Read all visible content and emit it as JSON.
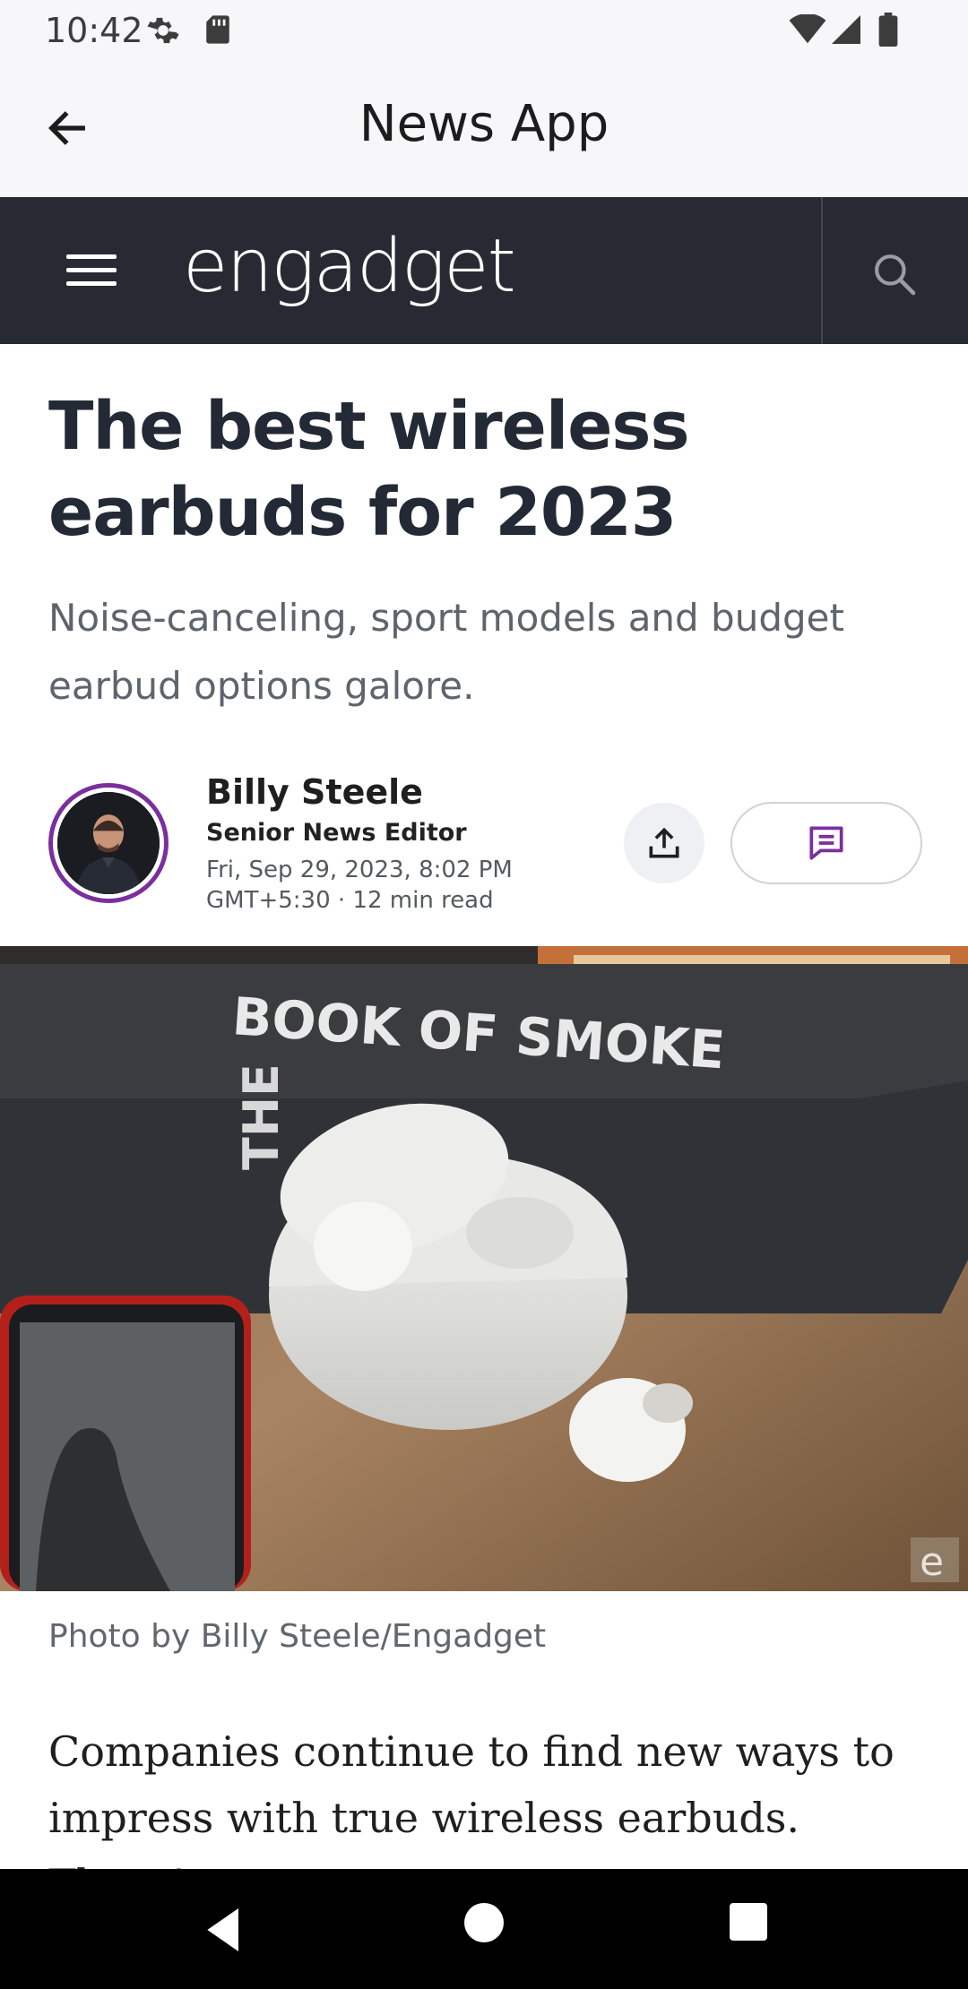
{
  "status_bar": {
    "time": "10:42",
    "icons": [
      "settings-gear-icon",
      "sd-card-icon",
      "wifi-icon",
      "cell-signal-icon",
      "battery-icon"
    ]
  },
  "app_bar": {
    "title": "News App",
    "back_icon": "arrow-left-icon"
  },
  "site_header": {
    "logo": "engadget",
    "menu_icon": "hamburger-menu-icon",
    "search_icon": "search-icon",
    "background": "#272a33"
  },
  "article": {
    "headline": "The best wireless earbuds for 2023",
    "subhead": "Noise-canceling, sport models and budget earbud options galore.",
    "author": {
      "name": "Billy Steele",
      "role": "Senior News Editor",
      "date_line1": "Fri, Sep 29, 2023, 8:02 PM",
      "date_line2": "GMT+5:30 · 12 min read",
      "avatar_ring_color": "#7b2f9e"
    },
    "actions": {
      "share_icon": "share-upload-icon",
      "comment_icon": "comment-icon",
      "comment_color": "#7b2f9e"
    },
    "hero_image": {
      "book_title": "BOOK OF SMOKE",
      "book_spine": "THE"
    },
    "photo_credit": "Photo by Billy Steele/Engadget",
    "body_text": "Companies continue to find new ways to impress with true wireless earbuds. There’s"
  },
  "nav_bar": {
    "icons": [
      "nav-back-icon",
      "nav-home-icon",
      "nav-recents-icon"
    ]
  }
}
